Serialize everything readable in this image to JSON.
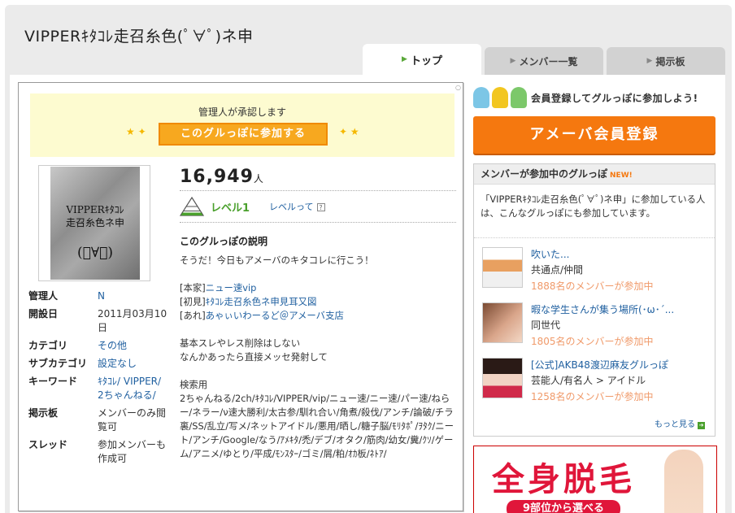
{
  "title": "VIPPERｷﾀｺﾚ走召糸色(ﾟ∀ﾟ)ネ申",
  "tabs": [
    {
      "label": "トップ",
      "active": true
    },
    {
      "label": "メンバー一覧",
      "active": false
    },
    {
      "label": "掲示板",
      "active": false
    }
  ],
  "join": {
    "approval_text": "管理人が承認します",
    "button_label": "このグルっぽに参加する"
  },
  "avatar": {
    "line1": "VIPPERｷﾀｺﾚ",
    "line2": "走召糸色ネ申",
    "face": "(ﾟ∀ﾟ)"
  },
  "info": {
    "rows": [
      {
        "key": "管理人",
        "value": "N"
      },
      {
        "key": "開設日",
        "value": "2011月03月10日"
      },
      {
        "key": "カテゴリ",
        "value": "その他"
      },
      {
        "key": "サブカテゴリ",
        "value": "設定なし"
      },
      {
        "key": "キーワード",
        "value": "ｷﾀｺﾚ/ VIPPER/ 2ちゃんねる/"
      },
      {
        "key": "掲示板",
        "value": "メンバーのみ閲覧可"
      },
      {
        "key": "スレッド",
        "value": "参加メンバーも作成可"
      }
    ]
  },
  "stats": {
    "member_count": "16,949",
    "member_unit": "人",
    "level": "レベル1",
    "level_link": "レベルって"
  },
  "description": {
    "title": "このグルっぽの説明",
    "line1": "そうだ！今日もアメーバのキタコレに行こう！",
    "honke_prefix": "[本家]",
    "honke_link": "ニュー速vip",
    "shoken_prefix": "[初見]",
    "shoken_link": "ｷﾀｺﾚ走召糸色ネ申見耳又図",
    "are_prefix": "[あれ]",
    "are_link": "あゃぃいわーるど＠アメーバ支店",
    "rule1": "基本スレやレス削除はしない",
    "rule2": "なんかあったら直接メッセ発射して",
    "search_label": "検索用",
    "search_text": "2ちゃんねる/2ch/ｷﾀｺﾚ/VIPPER/vip/ニュー速/ニー速/パー速/ねらー/ネラー/ν速大勝利/太古参/馴れ合い/角煮/殺伐/アンチ/論破/チラ裏/SS/乱立/写メ/ネットアイドル/悪用/晒し/糖子脳/ﾓﾘﾀﾎﾟ/ｦﾀｸ/ニート/アンチ/Google/なう/ｱﾒｷﾀ/禿/デブ/オタク/筋肉/幼女/糞/ｸｿ/ゲーム/アニメ/ゆとり/平成/ﾓﾝｽﾀｰ/ゴミ/屑/粕/ｵｶ板/ﾈﾄｱ/"
  },
  "sidebar": {
    "signup_text": "会員登録してグルっぽに参加しよう!",
    "ameba_button": "アメーバ会員登録",
    "groups_header": "メンバーが参加中のグルっぽ",
    "new_badge": "NEW!",
    "intro": "「VIPPERｷﾀｺﾚ走召糸色(ﾟ∀ﾟ)ネ申」に参加している人は、こんなグルっぽにも参加しています。",
    "groups": [
      {
        "title": "吹いた...",
        "common": "共通点/仲間",
        "members": "1888名のメンバーが参加中"
      },
      {
        "title": "暇な学生さんが集う場所(･ω･´...",
        "common": "同世代",
        "members": "1805名のメンバーが参加中"
      },
      {
        "title": "[公式]AKB48渡辺麻友グルっぽ",
        "common": "芸能人/有名人 > アイドル",
        "members": "1258名のメンバーが参加中"
      }
    ],
    "more_label": "もっと見る"
  },
  "ad": {
    "title": "全身脱毛",
    "sub": "9部位から選べる"
  },
  "colors": {
    "accent_orange": "#f5780f",
    "link_blue": "#2060a0",
    "level_green": "#4aa02c",
    "banner_yellow": "#fdfbd0"
  }
}
